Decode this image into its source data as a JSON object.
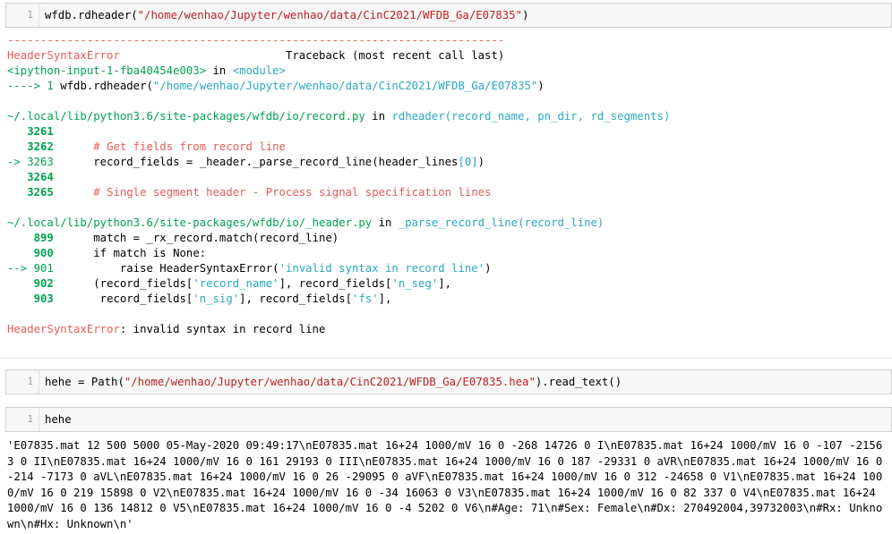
{
  "cells": [
    {
      "prompt": "1",
      "code_fn": "wfdb.rdheader(",
      "code_str": "\"/home/wenhao/Jupyter/wenhao/data/CinC2021/WFDB_Ga/E07835\"",
      "code_end": ")"
    },
    {
      "prompt": "1",
      "code_a": "hehe ",
      "code_op": "=",
      "code_b": " Path(",
      "code_str": "\"/home/wenhao/Jupyter/wenhao/data/CinC2021/WFDB_Ga/E07835.hea\"",
      "code_end": ").read_text()"
    },
    {
      "prompt": "1",
      "code": "hehe"
    }
  ],
  "traceback": {
    "dashes": "---------------------------------------------------------------------------",
    "err_name": "HeaderSyntaxError",
    "tb_label": "Traceback (most recent call last)",
    "input_ref": "<ipython-input-1-fba40454e003>",
    "in": " in ",
    "module": "<module>",
    "arrow1": "----> 1 ",
    "line1_fn": "wfdb.rdheader(",
    "line1_str": "\"/home/wenhao/Jupyter/wenhao/data/CinC2021/WFDB_Ga/E07835\"",
    "line1_end": ")",
    "file1": "~/.local/lib/python3.6/site-packages/wfdb/io/record.py",
    "file1_in": " in ",
    "file1_fn": "rdheader(record_name, pn_dir, rd_segments)",
    "f1_l1_num": "3261",
    "f1_l2_num": "3262",
    "f1_l2_text": "# Get fields from record line",
    "f1_l3_arrow": "-> 3263",
    "f1_l3_text": "record_fields = _header._parse_record_line(header_lines",
    "f1_l3_idx": "[0]",
    "f1_l3_end": ")",
    "f1_l4_num": "3264",
    "f1_l5_num": "3265",
    "f1_l5_text": "# Single segment header - Process signal specification lines",
    "file2": "~/.local/lib/python3.6/site-packages/wfdb/io/_header.py",
    "file2_in": " in ",
    "file2_fn": "_parse_record_line(record_line)",
    "f2_l1_num": "899",
    "f2_l1_text": "match = _rx_record.match(record_line)",
    "f2_l2_num": "900",
    "f2_l2_text": "if match is None:",
    "f2_l3_arrow": "--> 901",
    "f2_l3_kw": "raise ",
    "f2_l3_fn": "HeaderSyntaxError(",
    "f2_l3_str": "'invalid syntax in record line'",
    "f2_l3_end": ")",
    "f2_l4_num": "902",
    "f2_l4_a": "(record_fields[",
    "f2_l4_s1": "'record_name'",
    "f2_l4_b": "], record_fields[",
    "f2_l4_s2": "'n_seg'",
    "f2_l4_c": "],",
    "f2_l5_num": "903",
    "f2_l5_a": " record_fields[",
    "f2_l5_s1": "'n_sig'",
    "f2_l5_b": "], record_fields[",
    "f2_l5_s2": "'fs'",
    "f2_l5_c": "],",
    "final_err": "HeaderSyntaxError",
    "final_msg": ": invalid syntax in record line"
  },
  "result_text": "'E07835.mat 12 500 5000 05-May-2020 09:49:17\\nE07835.mat 16+24 1000/mV 16 0 -268 14726 0 I\\nE07835.mat 16+24 1000/mV 16 0 -107 -21563 0 II\\nE07835.mat 16+24 1000/mV 16 0 161 29193 0 III\\nE07835.mat 16+24 1000/mV 16 0 187 -29331 0 aVR\\nE07835.mat 16+24 1000/mV 16 0 -214 -7173 0 aVL\\nE07835.mat 16+24 1000/mV 16 0 26 -29095 0 aVF\\nE07835.mat 16+24 1000/mV 16 0 312 -24658 0 V1\\nE07835.mat 16+24 1000/mV 16 0 219 15898 0 V2\\nE07835.mat 16+24 1000/mV 16 0 -34 16063 0 V3\\nE07835.mat 16+24 1000/mV 16 0 82 337 0 V4\\nE07835.mat 16+24 1000/mV 16 0 136 14812 0 V5\\nE07835.mat 16+24 1000/mV 16 0 -4 5202 0 V6\\n#Age: 71\\n#Sex: Female\\n#Dx: 270492004,39732003\\n#Rx: Unknown\\n#Hx: Unknown\\n'"
}
